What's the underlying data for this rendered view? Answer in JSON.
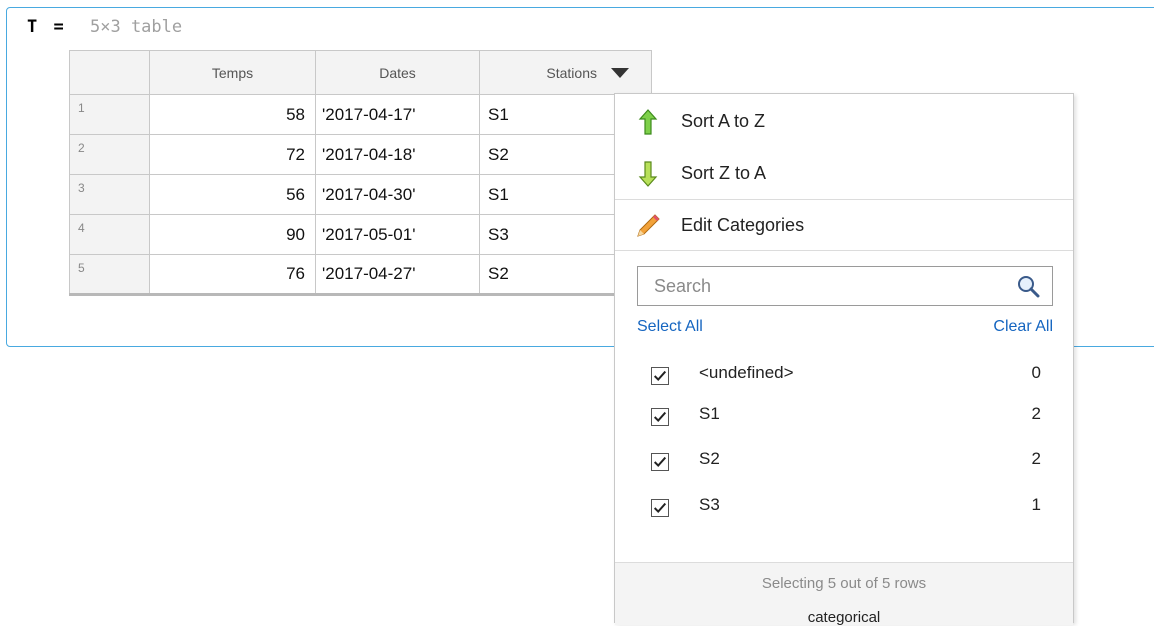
{
  "variable": {
    "name": "T",
    "equals": "=",
    "dims": "5×3 table"
  },
  "table": {
    "headers": [
      "Temps",
      "Dates",
      "Stations"
    ],
    "rows": [
      {
        "num": "1",
        "temps": "58",
        "dates": "'2017-04-17'",
        "station": "S1"
      },
      {
        "num": "2",
        "temps": "72",
        "dates": "'2017-04-18'",
        "station": "S2"
      },
      {
        "num": "3",
        "temps": "56",
        "dates": "'2017-04-30'",
        "station": "S1"
      },
      {
        "num": "4",
        "temps": "90",
        "dates": "'2017-05-01'",
        "station": "S3"
      },
      {
        "num": "5",
        "temps": "76",
        "dates": "'2017-04-27'",
        "station": "S2"
      }
    ]
  },
  "menu": {
    "sort_asc": "Sort A to Z",
    "sort_desc": "Sort Z to A",
    "edit_categories": "Edit Categories",
    "search_placeholder": "Search",
    "select_all": "Select All",
    "clear_all": "Clear All",
    "categories": [
      {
        "name": "<undefined>",
        "count": "0",
        "checked": true
      },
      {
        "name": "S1",
        "count": "2",
        "checked": true
      },
      {
        "name": "S2",
        "count": "2",
        "checked": true
      },
      {
        "name": "S3",
        "count": "1",
        "checked": true
      }
    ],
    "selection_status": "Selecting 5 out of 5 rows",
    "type": "categorical"
  },
  "colors": {
    "frame_border": "#49a9e0",
    "link": "#1565c0",
    "sort_asc_arrow": "#5cb82e",
    "sort_desc_arrow": "#5cb82e",
    "pencil": "#f2a23a"
  },
  "icons": [
    "sort-ascending-icon",
    "sort-descending-icon",
    "pencil-icon",
    "search-icon",
    "checkmark-icon",
    "dropdown-arrow-icon"
  ]
}
